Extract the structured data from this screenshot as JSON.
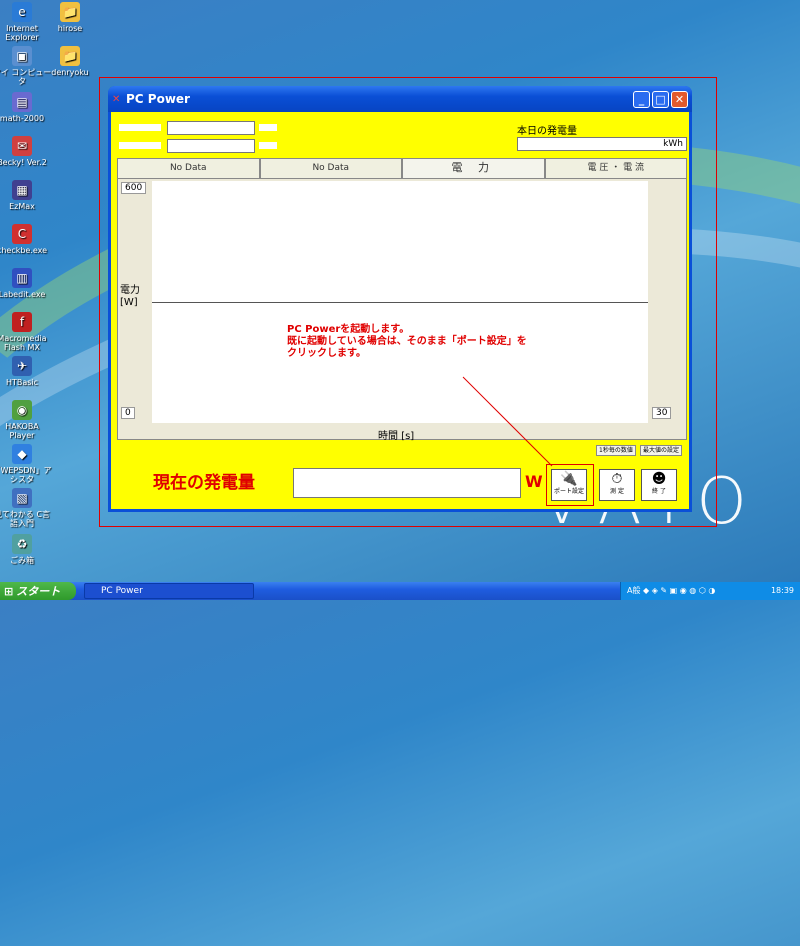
{
  "desktop": {
    "icons": [
      {
        "label": "Internet Explorer",
        "glyph": "e",
        "color": "#2a7bd6"
      },
      {
        "label": "hirose",
        "glyph": "📁",
        "color": "#f0c040"
      },
      {
        "label": "マイ コンピュータ",
        "glyph": "▣",
        "color": "#5a8fd0"
      },
      {
        "label": "denryoku",
        "glyph": "📁",
        "color": "#f0c040"
      },
      {
        "label": "math-2000",
        "glyph": "▤",
        "color": "#6a6ad0"
      },
      {
        "label": "Becky! Ver.2",
        "glyph": "✉",
        "color": "#d04040"
      },
      {
        "label": "EzMax",
        "glyph": "▦",
        "color": "#404090"
      },
      {
        "label": "checkbe.exe",
        "glyph": "C",
        "color": "#d03030"
      },
      {
        "label": "Labedit.exe",
        "glyph": "▥",
        "color": "#3050c0"
      },
      {
        "label": "Macromedia Flash MX",
        "glyph": "f",
        "color": "#c02020"
      },
      {
        "label": "HTBasic",
        "glyph": "✈",
        "color": "#3060b0"
      },
      {
        "label": "HAKOBA Player",
        "glyph": "◉",
        "color": "#50a040"
      },
      {
        "label": "「WEPSDN」アシスタ",
        "glyph": "◆",
        "color": "#3080e0"
      },
      {
        "label": "見てわかる C言語入門",
        "glyph": "▧",
        "color": "#4070c0"
      },
      {
        "label": "ごみ箱",
        "glyph": "♻",
        "color": "#50a0a0"
      }
    ],
    "brand": "VAIO"
  },
  "window": {
    "title": "PC Power",
    "buttons": {
      "minimize": "_",
      "maximize": "□",
      "close": "✕"
    }
  },
  "top": {
    "today_label": "本日の発電量",
    "today_unit": "kWh",
    "today_value": ""
  },
  "tabs": [
    {
      "label": "No Data",
      "active": false
    },
    {
      "label": "No Data",
      "active": false
    },
    {
      "label": "電 力",
      "active": true
    },
    {
      "label": "電 圧 ・ 電 流",
      "active": false
    }
  ],
  "graph": {
    "y_max": "600",
    "y_min": "0",
    "x_max": "30",
    "y_label": "電力\n[W]",
    "x_label": "時間 [s]",
    "btn_1sec": "1秒毎の数値",
    "btn_max": "最大値の設定"
  },
  "annotation": {
    "line1": "PC Powerを起動します。",
    "line2": "既に起動している場合は、そのまま「ポート設定」を",
    "line3": "クリックします。"
  },
  "bottom": {
    "current_label": "現在の発電量",
    "current_unit": "W",
    "current_value": "",
    "port_button": "ポート設定",
    "measure_button": "測 定",
    "exit_button": "終 了"
  },
  "taskbar": {
    "start": "スタート",
    "task_label": "PC Power",
    "clock": "18:39",
    "ime": "A般"
  }
}
